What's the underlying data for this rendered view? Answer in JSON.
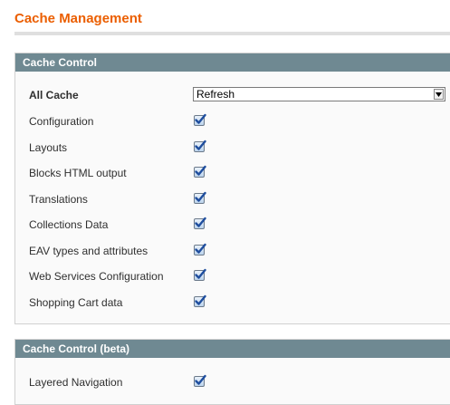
{
  "page": {
    "title": "Cache Management"
  },
  "cache_control": {
    "header": "Cache Control",
    "all_cache": {
      "label": "All Cache",
      "selected_option": "Refresh"
    },
    "items": [
      {
        "label": "Configuration",
        "checked": true
      },
      {
        "label": "Layouts",
        "checked": true
      },
      {
        "label": "Blocks HTML output",
        "checked": true
      },
      {
        "label": "Translations",
        "checked": true
      },
      {
        "label": "Collections Data",
        "checked": true
      },
      {
        "label": "EAV types and attributes",
        "checked": true
      },
      {
        "label": "Web Services Configuration",
        "checked": true
      },
      {
        "label": "Shopping Cart data",
        "checked": true
      }
    ]
  },
  "cache_control_beta": {
    "header": "Cache Control (beta)",
    "items": [
      {
        "label": "Layered Navigation",
        "checked": true
      }
    ]
  },
  "colors": {
    "title": "#eb5e00",
    "section_header_bg": "#6f8992",
    "checkmark": "#1f4e9e"
  },
  "icons": {
    "checkbox": "checkmark-icon",
    "select": "chevron-down-icon"
  }
}
